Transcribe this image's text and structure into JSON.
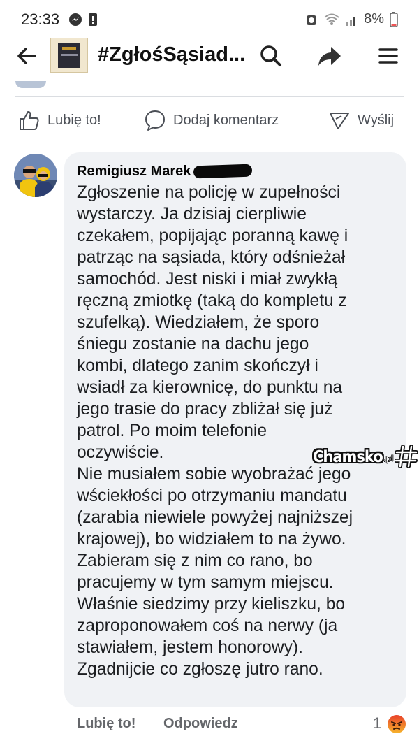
{
  "status_bar": {
    "time": "23:33",
    "battery": "8%"
  },
  "app_bar": {
    "title": "#ZgłośSąsiad..."
  },
  "post_actions": {
    "like": "Lubię to!",
    "comment": "Dodaj komentarz",
    "send": "Wyślij"
  },
  "comment": {
    "author": "Remigiusz Marek",
    "lines": [
      "Zgłoszenie na policję w zupełności",
      "wystarczy. Ja dzisiaj cierpliwie",
      "czekałem, popijając poranną kawę i",
      "patrząc na sąsiada, który odśnieżał",
      "samochód. Jest niski i miał zwykłą",
      "ręczną zmiotkę (taką do kompletu z",
      "szufelką). Wiedziałem, że sporo",
      "śniegu zostanie na dachu jego",
      "kombi, dlatego zanim skończył i",
      "wsiadł za kierownicę, do punktu na",
      "jego trasie do pracy zbliżał się już",
      "patrol. Po moim telefonie",
      "oczywiście.",
      "Nie musiałem sobie wyobrażać jego",
      "wściekłości po otrzymaniu mandatu",
      "(zarabia niewiele powyżej najniższej",
      "krajowej), bo widziałem to na żywo.",
      "Zabieram się z nim co rano, bo",
      "pracujemy w tym samym miejscu.",
      "Właśnie siedzimy przy kieliszku, bo",
      "zaproponowałem coś na nerwy (ja",
      "stawiałem, jestem honorowy).",
      "Zgadnijcie co zgłoszę jutro rano."
    ]
  },
  "comment_actions": {
    "like": "Lubię to!",
    "reply": "Odpowiedz",
    "reaction_count": "1",
    "reaction_icon": "angry-reaction-icon"
  },
  "watermark": {
    "text": "Chamsko",
    "suffix": ".pl"
  },
  "colors": {
    "bubble": "#f0f2f5",
    "text": "#1c1e21",
    "secondary_text": "#65676b",
    "angry_reaction": "#e9710f"
  }
}
